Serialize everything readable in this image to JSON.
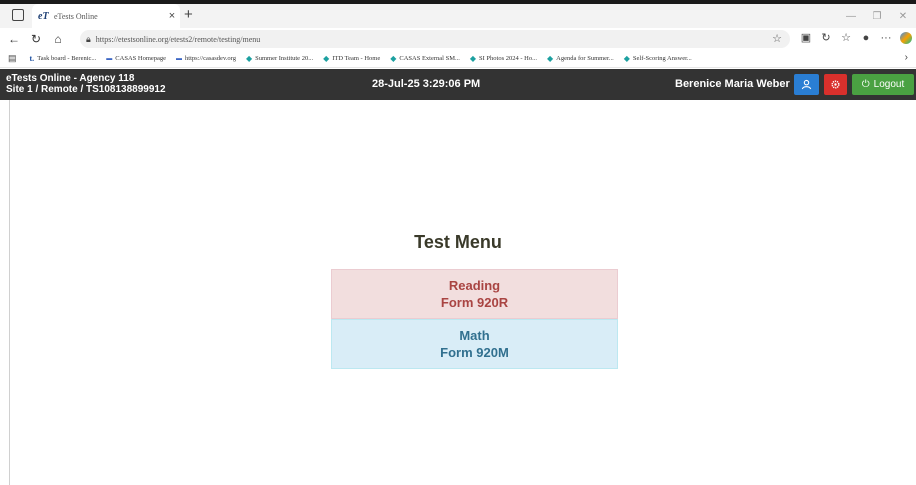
{
  "browser": {
    "tab": {
      "favicon": "eT",
      "title": "eTests Online",
      "close": "×"
    },
    "new_tab": "+",
    "url": "https://etestsonline.org/etests2/remote/testing/menu",
    "bookmarks": [
      {
        "icon": "t.",
        "label": "Task board - Berenic..."
      },
      {
        "icon": "casas",
        "label": "CASAS Homepage"
      },
      {
        "icon": "casas",
        "label": "https://casasdev.org"
      },
      {
        "icon": "teams",
        "label": "Summer Institute 20..."
      },
      {
        "icon": "teams",
        "label": "ITD Team - Home"
      },
      {
        "icon": "teams",
        "label": "CASAS External SM..."
      },
      {
        "icon": "teams",
        "label": "SI Photos 2024 - Ho..."
      },
      {
        "icon": "teams",
        "label": "Agenda for Summer..."
      },
      {
        "icon": "teams",
        "label": "Self-Scoring Answer..."
      }
    ]
  },
  "header": {
    "agency_line1": "eTests Online - Agency 118",
    "agency_line2": "Site 1 / Remote / TS108138899912",
    "datetime": "28-Jul-25 3:29:06 PM",
    "user_name": "Berenice Maria Weber",
    "logout_label": "Logout",
    "colors": {
      "bar": "#333333",
      "profile": "#2a7ed4",
      "settings": "#d9302c",
      "logout": "#4aa142"
    }
  },
  "main": {
    "title": "Test Menu",
    "tests": [
      {
        "subject": "Reading",
        "form": "Form 920R",
        "color": "#a94442",
        "bg": "#f2dede"
      },
      {
        "subject": "Math",
        "form": "Form 920M",
        "color": "#31708f",
        "bg": "#d9edf7"
      }
    ]
  }
}
